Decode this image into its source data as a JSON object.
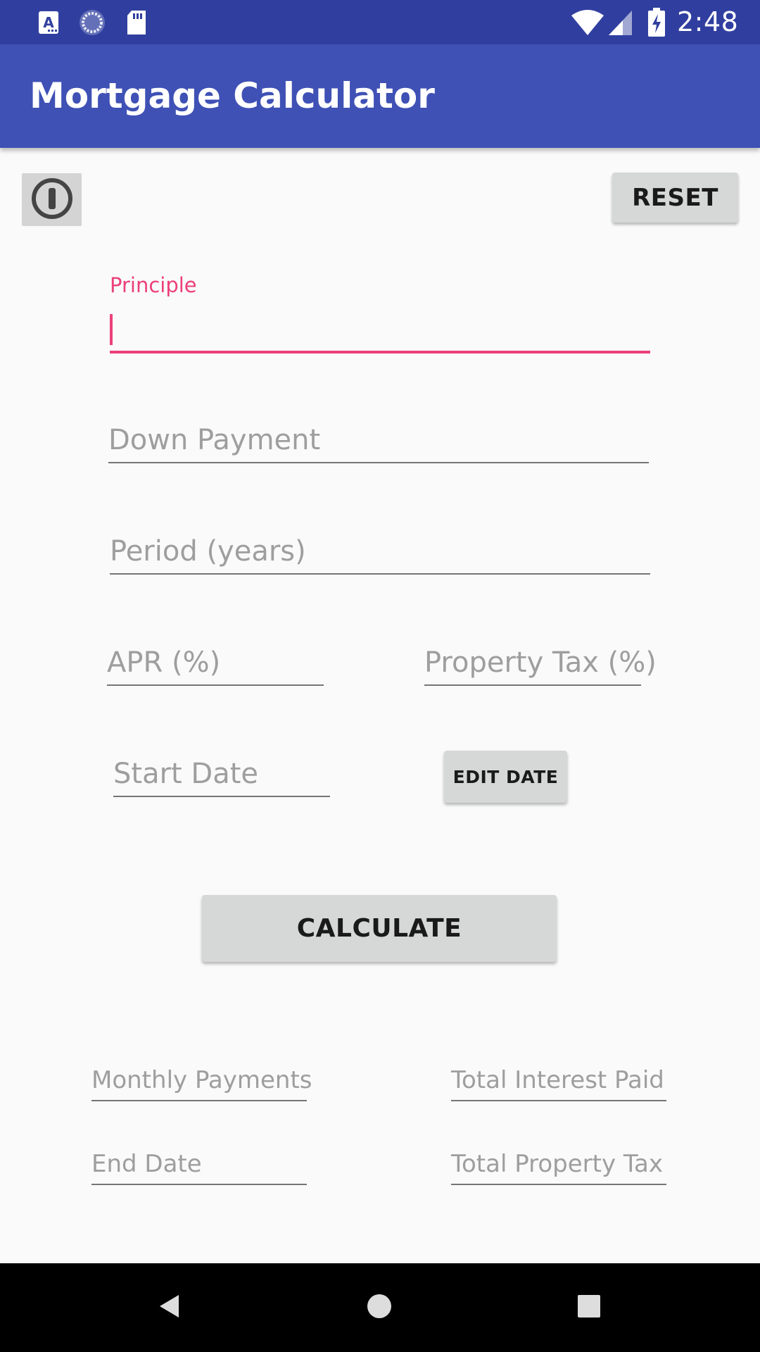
{
  "status_bar": {
    "time": "2:48",
    "icons": [
      "a-letter-icon",
      "sync-icon",
      "sd-card-icon",
      "wifi-icon",
      "signal-icon",
      "battery-charging-icon"
    ]
  },
  "app_bar": {
    "title": "Mortgage Calculator"
  },
  "toolbar": {
    "info_icon": "info-icon",
    "reset_label": "RESET"
  },
  "form": {
    "principle": {
      "label": "Principle",
      "value": ""
    },
    "down_payment": {
      "placeholder": "Down Payment",
      "value": ""
    },
    "period": {
      "placeholder": "Period (years)",
      "value": ""
    },
    "apr": {
      "placeholder": "APR (%)",
      "value": ""
    },
    "property_tax": {
      "placeholder": "Property Tax (%)",
      "value": ""
    },
    "start_date": {
      "placeholder": "Start Date",
      "value": ""
    },
    "edit_date_label": "EDIT DATE",
    "calculate_label": "CALCULATE"
  },
  "results": {
    "monthly_payments": "Monthly Payments",
    "total_interest_paid": "Total Interest Paid",
    "end_date": "End Date",
    "total_property_tax": "Total Property Tax"
  },
  "nav_bar": {
    "buttons": [
      "back-icon",
      "home-icon",
      "recents-icon"
    ]
  },
  "colors": {
    "primary": "#3f51b5",
    "primary_dark": "#303f9f",
    "accent": "#ec407a",
    "background": "#fafafa",
    "button": "#d6d7d7"
  }
}
